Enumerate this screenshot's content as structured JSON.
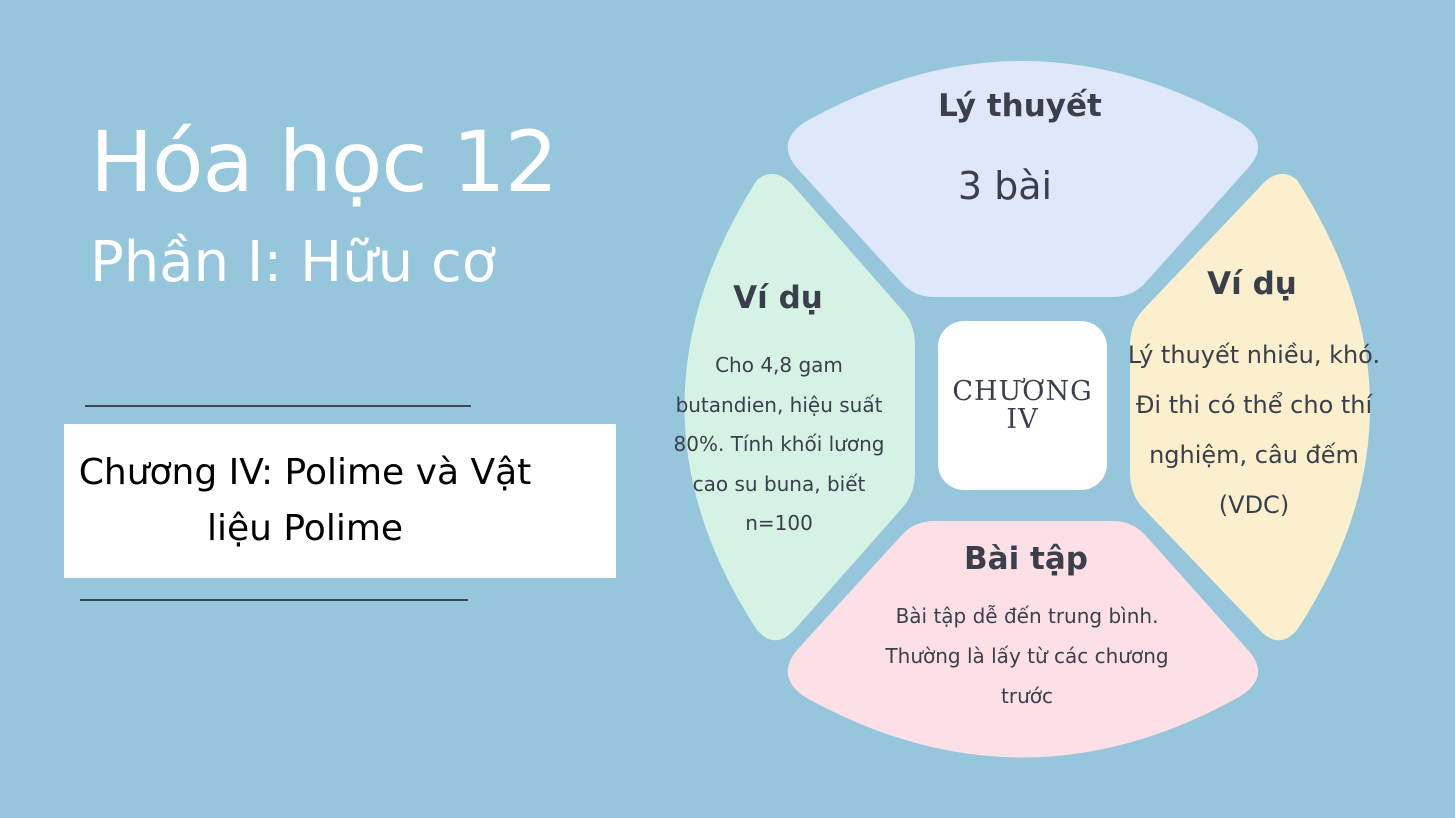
{
  "title": "Hóa học 12",
  "subtitle": "Phần I: Hữu cơ",
  "chapter_title": "Chương IV: Polime và Vật liệu Polime",
  "center": "CHƯƠNG IV",
  "segments": {
    "top": {
      "heading": "Lý thuyết",
      "body": "3 bài",
      "color": "#dfe8fb"
    },
    "left": {
      "heading": "Ví dụ",
      "body": "Cho 4,8 gam butandien, hiệu suất 80%. Tính khối lương cao su buna, biết n=100",
      "color": "#d5f2e5"
    },
    "right": {
      "heading": "Ví dụ",
      "body": "Lý thuyết nhiều, khó. Đi thi có thể cho thí nghiệm, câu đếm (VDC)",
      "color": "#fcefcd"
    },
    "bottom": {
      "heading": "Bài tập",
      "body": "Bài tập dễ đến trung bình. Thường là lấy từ các chương trước",
      "color": "#fde0e5"
    }
  }
}
